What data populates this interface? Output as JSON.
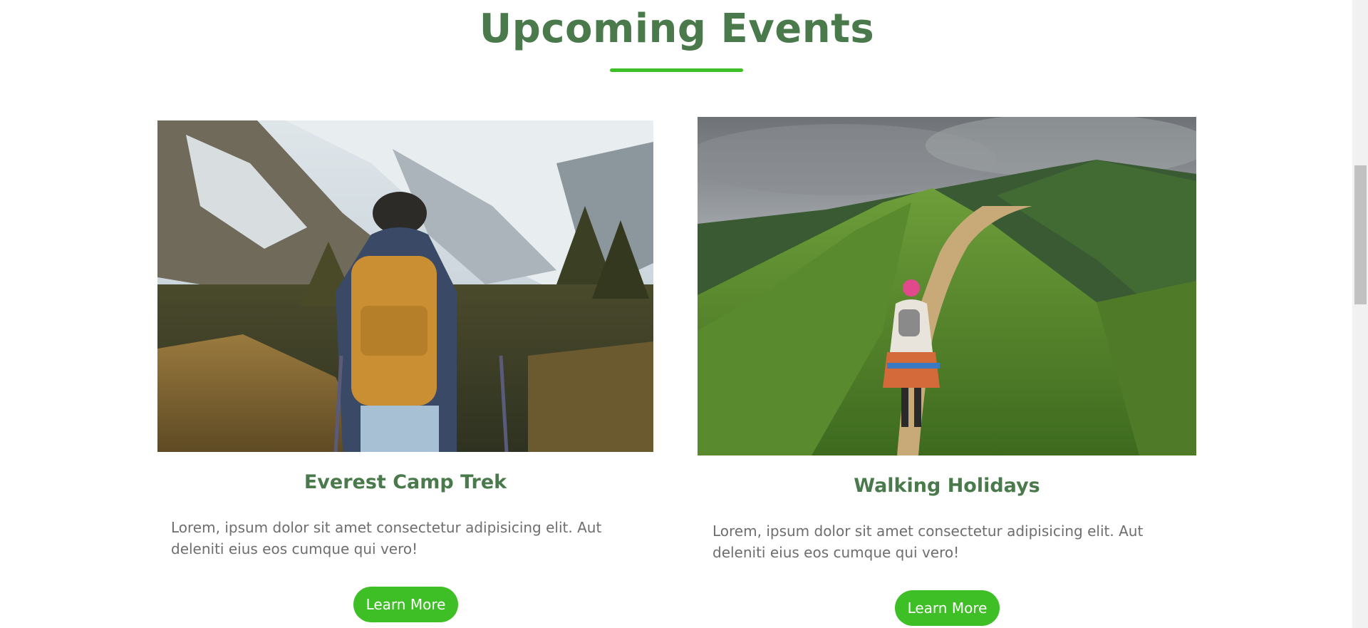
{
  "section": {
    "title": "Upcoming Events"
  },
  "events": [
    {
      "title": "Everest Camp Trek",
      "description": "Lorem, ipsum dolor sit amet consectetur adipisicing elit. Aut deleniti eius eos cumque qui vero!",
      "button_label": "Learn More"
    },
    {
      "title": "Walking Holidays",
      "description": "Lorem, ipsum dolor sit amet consectetur adipisicing elit. Aut deleniti eius eos cumque qui vero!",
      "button_label": "Learn More"
    }
  ],
  "colors": {
    "heading": "#4a7a4c",
    "accent": "#3fbf26",
    "body_text": "#6e6e6e"
  }
}
